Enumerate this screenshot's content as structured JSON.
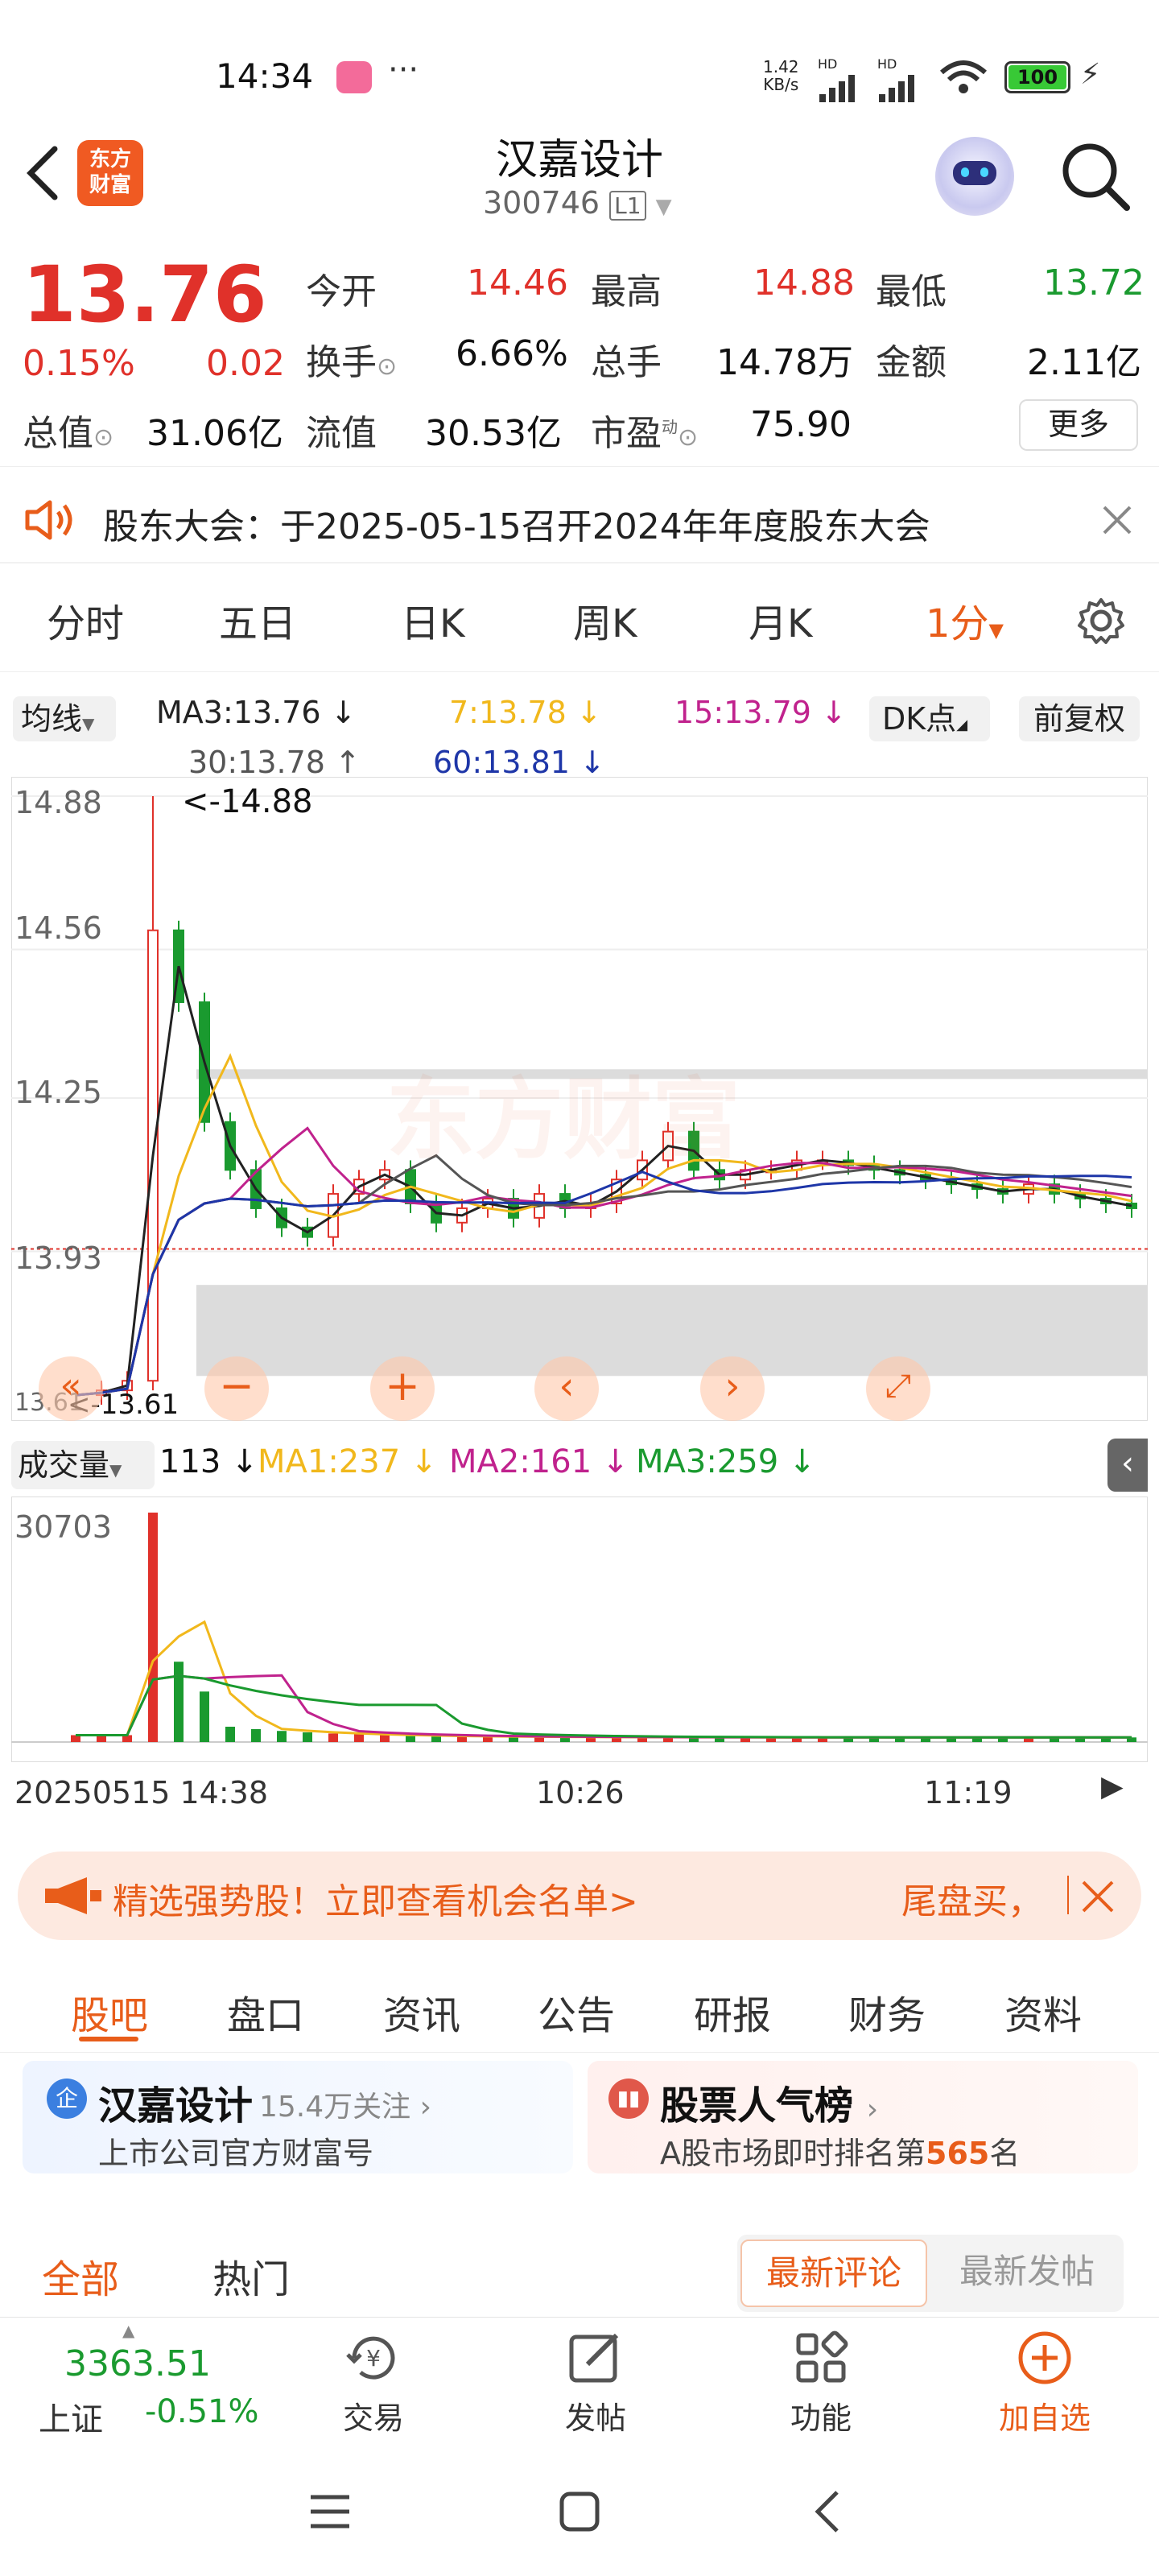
{
  "status": {
    "time": "14:34",
    "net_speed_top": "1.42",
    "net_speed_bottom": "KB/s",
    "hd1": "HD",
    "hd2": "HD",
    "battery": "100"
  },
  "header": {
    "logo_text_line1": "东方",
    "logo_text_line2": "财富",
    "title": "汉嘉设计",
    "code": "300746",
    "level": "L1"
  },
  "quote": {
    "price": "13.76",
    "change_pct": "0.15%",
    "change": "0.02",
    "stats": [
      {
        "label": "今开",
        "value": "14.46",
        "color": "red"
      },
      {
        "label": "最高",
        "value": "14.88",
        "color": "red"
      },
      {
        "label": "最低",
        "value": "13.72",
        "color": "green"
      },
      {
        "label": "换手",
        "value": "6.66%",
        "color": "black"
      },
      {
        "label": "总手",
        "value": "14.78万",
        "color": "black"
      },
      {
        "label": "金额",
        "value": "2.11亿",
        "color": "black"
      },
      {
        "label": "总值",
        "value": "31.06亿",
        "color": "black"
      },
      {
        "label": "流值",
        "value": "30.53亿",
        "color": "black"
      },
      {
        "label": "市盈",
        "value": "75.90",
        "color": "black"
      }
    ],
    "pe_superscript": "动",
    "more_label": "更多"
  },
  "notice": {
    "text": "股东大会：于2025-05-15召开2024年年度股东大会"
  },
  "chart_tabs": [
    "分时",
    "五日",
    "日K",
    "周K",
    "月K",
    "1分"
  ],
  "ma_legend": {
    "selector": "均线",
    "ma3": "MA3:13.76",
    "ma7": "7:13.78",
    "ma15": "15:13.79",
    "ma30": "30:13.78",
    "ma60": "60:13.81",
    "dk_label": "DK点",
    "fq_label": "前复权"
  },
  "price_axis": {
    "labels": [
      "14.88",
      "14.56",
      "14.25",
      "13.93",
      "13.61"
    ],
    "high_marker": "<-14.88",
    "low_marker": "<-13.61",
    "watermark": "东方财富"
  },
  "volume": {
    "selector": "成交量",
    "current": "113",
    "ma1": "MA1:237",
    "ma2": "MA2:161",
    "ma3": "MA3:259",
    "max_label": "30703"
  },
  "time_axis": {
    "start": "20250515 14:38",
    "mid": "10:26",
    "end": "11:19"
  },
  "colors": {
    "red": "#e0312a",
    "green": "#1a9a2f",
    "accent": "#e85d1a",
    "ma3": "#222222",
    "ma7": "#f1b81c",
    "ma15": "#c0228d",
    "ma30": "#555555",
    "ma60": "#1e36a8"
  },
  "chart_data": {
    "type": "candlestick",
    "interval": "1分",
    "price_ylim": [
      13.61,
      14.88
    ],
    "high": 14.88,
    "low": 13.61,
    "volume_ymax": 30703,
    "ma_values": {
      "MA3": 13.76,
      "MA7": 13.78,
      "MA15": 13.79,
      "MA30": 13.78,
      "MA60": 13.81
    },
    "close_path_approx": [
      13.63,
      13.64,
      13.66,
      14.6,
      14.45,
      14.2,
      14.1,
      14.02,
      13.98,
      13.96,
      14.05,
      14.08,
      14.1,
      14.03,
      13.99,
      14.02,
      14.04,
      14.0,
      14.05,
      14.02,
      14.03,
      14.08,
      14.12,
      14.18,
      14.1,
      14.08,
      14.1,
      14.1,
      14.12,
      14.12,
      14.11,
      14.1,
      14.09,
      14.08,
      14.07,
      14.06,
      14.05,
      14.07,
      14.05,
      14.04,
      14.03,
      14.02
    ]
  },
  "ad": {
    "text": "精选强势股！立即查看机会名单>",
    "right_text": "尾盘买，"
  },
  "section_tabs": [
    "股吧",
    "盘口",
    "资讯",
    "公告",
    "研报",
    "财务",
    "资料"
  ],
  "cards": {
    "left_title": "汉嘉设计",
    "left_follow": "15.4万关注",
    "left_sub": "上市公司官方财富号",
    "right_title": "股票人气榜",
    "right_sub_prefix": "A股市场即时排名第",
    "right_rank": "565",
    "right_sub_suffix": "名"
  },
  "sub_tabs": {
    "all": "全部",
    "hot": "热门",
    "latest_comment": "最新评论",
    "latest_post": "最新发帖"
  },
  "bottom_nav": {
    "index_value": "3363.51",
    "index_name": "上证",
    "index_change": "-0.51%",
    "trade": "交易",
    "post": "发帖",
    "func": "功能",
    "add": "加自选"
  }
}
